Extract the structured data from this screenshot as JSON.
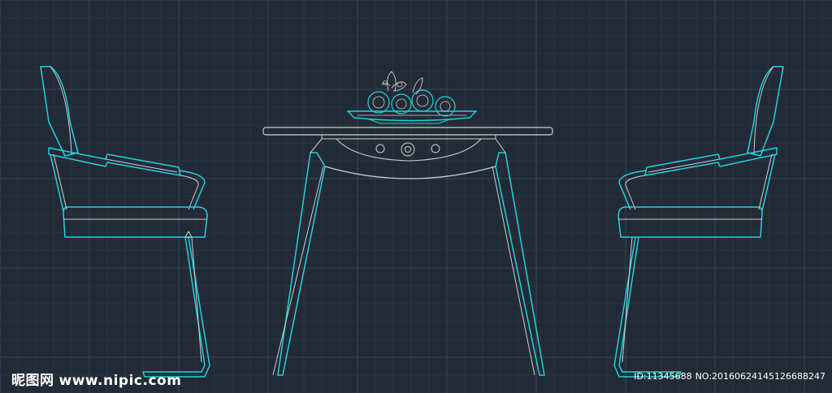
{
  "watermark": {
    "logo_text": "昵图网",
    "site": "www.nipic.com",
    "id_text": "ID:11345688",
    "no_text": "NO:20160624145126688247"
  },
  "colors": {
    "background": "#222a35",
    "grid_minor": "#2b3440",
    "grid_major": "#3a4452",
    "cyan": "#1fd3db",
    "white_line": "#c8d0d8"
  }
}
